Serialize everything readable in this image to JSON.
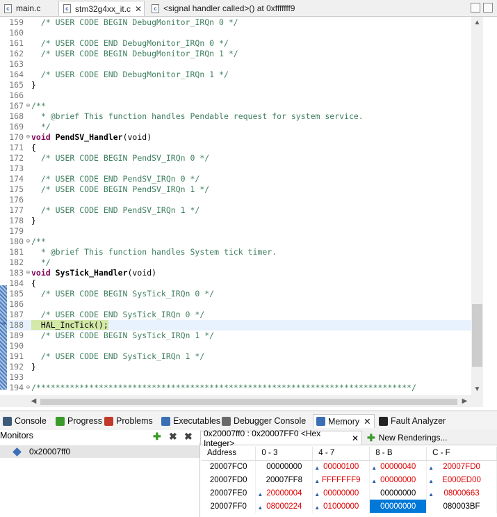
{
  "editor_tabs": [
    {
      "label": "main.c"
    },
    {
      "label": "stm32g4xx_it.c",
      "close": "✕"
    },
    {
      "label": "<signal handler called>() at 0xfffffff9"
    }
  ],
  "code_lines": [
    {
      "n": "159",
      "fold": "",
      "kind": "comment",
      "text": "  /* USER CODE BEGIN DebugMonitor_IRQn 0 */"
    },
    {
      "n": "160",
      "fold": "",
      "kind": "plain",
      "text": ""
    },
    {
      "n": "161",
      "fold": "",
      "kind": "comment",
      "text": "  /* USER CODE END DebugMonitor_IRQn 0 */"
    },
    {
      "n": "162",
      "fold": "",
      "kind": "comment",
      "text": "  /* USER CODE BEGIN DebugMonitor_IRQn 1 */"
    },
    {
      "n": "163",
      "fold": "",
      "kind": "plain",
      "text": ""
    },
    {
      "n": "164",
      "fold": "",
      "kind": "comment",
      "text": "  /* USER CODE END DebugMonitor_IRQn 1 */"
    },
    {
      "n": "165",
      "fold": "",
      "kind": "plain",
      "text": "}"
    },
    {
      "n": "166",
      "fold": "",
      "kind": "plain",
      "text": ""
    },
    {
      "n": "167",
      "fold": "⊖",
      "kind": "comment",
      "text": "/**"
    },
    {
      "n": "168",
      "fold": "",
      "kind": "comment",
      "text": "  * @brief This function handles Pendable request for system service."
    },
    {
      "n": "169",
      "fold": "",
      "kind": "comment",
      "text": "  */"
    },
    {
      "n": "170",
      "fold": "⊖",
      "kind": "func",
      "kw": "void",
      "name": "PendSV_Handler",
      "rest": "(void)"
    },
    {
      "n": "171",
      "fold": "",
      "kind": "plain",
      "text": "{"
    },
    {
      "n": "172",
      "fold": "",
      "kind": "comment",
      "text": "  /* USER CODE BEGIN PendSV_IRQn 0 */"
    },
    {
      "n": "173",
      "fold": "",
      "kind": "plain",
      "text": ""
    },
    {
      "n": "174",
      "fold": "",
      "kind": "comment",
      "text": "  /* USER CODE END PendSV_IRQn 0 */"
    },
    {
      "n": "175",
      "fold": "",
      "kind": "comment",
      "text": "  /* USER CODE BEGIN PendSV_IRQn 1 */"
    },
    {
      "n": "176",
      "fold": "",
      "kind": "plain",
      "text": ""
    },
    {
      "n": "177",
      "fold": "",
      "kind": "comment",
      "text": "  /* USER CODE END PendSV_IRQn 1 */"
    },
    {
      "n": "178",
      "fold": "",
      "kind": "plain",
      "text": "}"
    },
    {
      "n": "179",
      "fold": "",
      "kind": "plain",
      "text": ""
    },
    {
      "n": "180",
      "fold": "⊖",
      "kind": "comment",
      "text": "/**"
    },
    {
      "n": "181",
      "fold": "",
      "kind": "comment",
      "text": "  * @brief This function handles System tick timer."
    },
    {
      "n": "182",
      "fold": "",
      "kind": "comment",
      "text": "  */"
    },
    {
      "n": "183",
      "fold": "⊖",
      "kind": "func",
      "kw": "void",
      "name": "SysTick_Handler",
      "rest": "(void)"
    },
    {
      "n": "184",
      "fold": "",
      "kind": "plain",
      "text": "{"
    },
    {
      "n": "185",
      "fold": "",
      "kind": "comment",
      "text": "  /* USER CODE BEGIN SysTick_IRQn 0 */"
    },
    {
      "n": "186",
      "fold": "",
      "kind": "plain",
      "text": ""
    },
    {
      "n": "187",
      "fold": "",
      "kind": "comment",
      "text": "  /* USER CODE END SysTick_IRQn 0 */"
    },
    {
      "n": "188",
      "fold": "",
      "kind": "current",
      "text": "  HAL_IncTick();"
    },
    {
      "n": "189",
      "fold": "",
      "kind": "comment",
      "text": "  /* USER CODE BEGIN SysTick_IRQn 1 */"
    },
    {
      "n": "190",
      "fold": "",
      "kind": "plain",
      "text": ""
    },
    {
      "n": "191",
      "fold": "",
      "kind": "comment",
      "text": "  /* USER CODE END SysTick_IRQn 1 */"
    },
    {
      "n": "192",
      "fold": "",
      "kind": "plain",
      "text": "}"
    },
    {
      "n": "193",
      "fold": "",
      "kind": "plain",
      "text": ""
    },
    {
      "n": "194",
      "fold": "⊖",
      "kind": "comment",
      "text": "/******************************************************************************/"
    }
  ],
  "panel_tabs": [
    {
      "label": "Console",
      "color": "#3b5a7a"
    },
    {
      "label": "Progress",
      "color": "#3a9a2a"
    },
    {
      "label": "Problems",
      "color": "#c0392b"
    },
    {
      "label": "Executables",
      "color": "#3b6fb5"
    },
    {
      "label": "Debugger Console",
      "color": "#6a6a6a"
    },
    {
      "label": "Memory",
      "color": "#3b6fb5",
      "close": "✕"
    },
    {
      "label": "Fault Analyzer",
      "color": "#222222"
    }
  ],
  "monitors": {
    "title": "Monitors",
    "items": [
      "0x20007ff0"
    ]
  },
  "renderings": {
    "active_tab": "0x20007ff0 : 0x20007FF0 <Hex Integer>",
    "new_tab": "New Renderings...",
    "columns": [
      "Address",
      "0 - 3",
      "4 - 7",
      "8 - B",
      "C - F"
    ],
    "rows": [
      {
        "addr": "20007FC0",
        "cells": [
          {
            "v": "00000000",
            "red": false,
            "tri": false
          },
          {
            "v": "00000100",
            "red": true,
            "tri": true
          },
          {
            "v": "00000040",
            "red": true,
            "tri": true
          },
          {
            "v": "20007FD0",
            "red": true,
            "tri": true
          }
        ]
      },
      {
        "addr": "20007FD0",
        "cells": [
          {
            "v": "20007FF8",
            "red": false,
            "tri": false
          },
          {
            "v": "FFFFFFF9",
            "red": true,
            "tri": true
          },
          {
            "v": "00000000",
            "red": true,
            "tri": true
          },
          {
            "v": "E000ED00",
            "red": true,
            "tri": true
          }
        ]
      },
      {
        "addr": "20007FE0",
        "cells": [
          {
            "v": "20000004",
            "red": true,
            "tri": true
          },
          {
            "v": "00000000",
            "red": true,
            "tri": true
          },
          {
            "v": "00000000",
            "red": false,
            "tri": false
          },
          {
            "v": "08000663",
            "red": true,
            "tri": true
          }
        ]
      },
      {
        "addr": "20007FF0",
        "cells": [
          {
            "v": "08000224",
            "red": true,
            "tri": true
          },
          {
            "v": "01000000",
            "red": true,
            "tri": true
          },
          {
            "v": "00000000",
            "red": false,
            "tri": false,
            "selected": true
          },
          {
            "v": "080003BF",
            "red": false,
            "tri": false
          }
        ]
      }
    ]
  }
}
